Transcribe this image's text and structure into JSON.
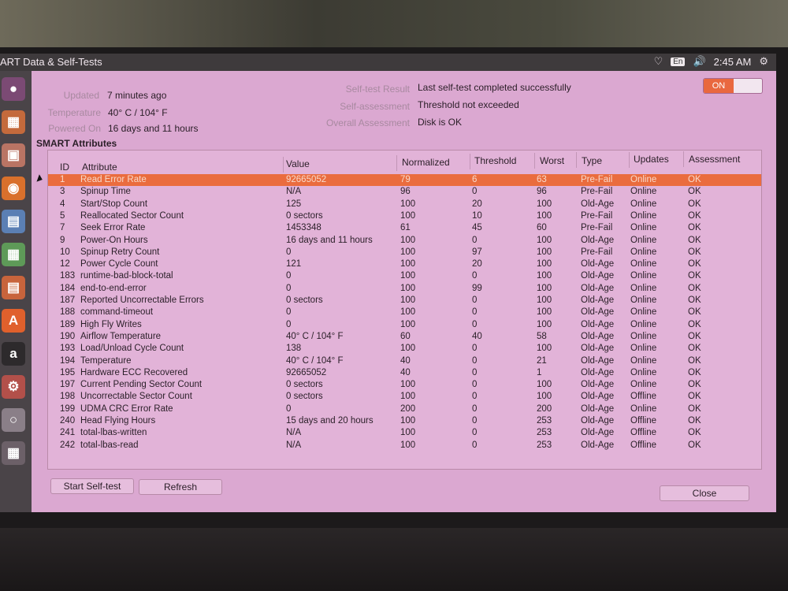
{
  "top_panel": {
    "window_title": "ART Data & Self-Tests",
    "keyboard_layout": "En",
    "clock": "2:45 AM"
  },
  "summary": {
    "updated_label": "Updated",
    "updated_value": "7 minutes ago",
    "temperature_label": "Temperature",
    "temperature_value": "40° C / 104° F",
    "powered_on_label": "Powered On",
    "powered_on_value": "16 days and 11 hours",
    "self_test_result_label": "Self-test Result",
    "self_test_result_value": "Last self-test completed successfully",
    "self_assessment_label": "Self-assessment",
    "self_assessment_value": "Threshold not exceeded",
    "overall_assessment_label": "Overall Assessment",
    "overall_assessment_value": "Disk is OK",
    "smart_toggle": "ON"
  },
  "section_title": "SMART Attributes",
  "table": {
    "headers": [
      "ID",
      "Attribute",
      "Value",
      "Normalized",
      "Threshold",
      "Worst",
      "Type",
      "Updates",
      "Assessment"
    ],
    "rows": [
      {
        "id": "1",
        "attribute": "Read Error Rate",
        "value": "92665052",
        "normalized": "79",
        "threshold": "6",
        "worst": "63",
        "type": "Pre-Fail",
        "updates": "Online",
        "assessment": "OK"
      },
      {
        "id": "3",
        "attribute": "Spinup Time",
        "value": "N/A",
        "normalized": "96",
        "threshold": "0",
        "worst": "96",
        "type": "Pre-Fail",
        "updates": "Online",
        "assessment": "OK"
      },
      {
        "id": "4",
        "attribute": "Start/Stop Count",
        "value": "125",
        "normalized": "100",
        "threshold": "20",
        "worst": "100",
        "type": "Old-Age",
        "updates": "Online",
        "assessment": "OK"
      },
      {
        "id": "5",
        "attribute": "Reallocated Sector Count",
        "value": "0 sectors",
        "normalized": "100",
        "threshold": "10",
        "worst": "100",
        "type": "Pre-Fail",
        "updates": "Online",
        "assessment": "OK"
      },
      {
        "id": "7",
        "attribute": "Seek Error Rate",
        "value": "1453348",
        "normalized": "61",
        "threshold": "45",
        "worst": "60",
        "type": "Pre-Fail",
        "updates": "Online",
        "assessment": "OK"
      },
      {
        "id": "9",
        "attribute": "Power-On Hours",
        "value": "16 days and 11 hours",
        "normalized": "100",
        "threshold": "0",
        "worst": "100",
        "type": "Old-Age",
        "updates": "Online",
        "assessment": "OK"
      },
      {
        "id": "10",
        "attribute": "Spinup Retry Count",
        "value": "0",
        "normalized": "100",
        "threshold": "97",
        "worst": "100",
        "type": "Pre-Fail",
        "updates": "Online",
        "assessment": "OK"
      },
      {
        "id": "12",
        "attribute": "Power Cycle Count",
        "value": "121",
        "normalized": "100",
        "threshold": "20",
        "worst": "100",
        "type": "Old-Age",
        "updates": "Online",
        "assessment": "OK"
      },
      {
        "id": "183",
        "attribute": "runtime-bad-block-total",
        "value": "0",
        "normalized": "100",
        "threshold": "0",
        "worst": "100",
        "type": "Old-Age",
        "updates": "Online",
        "assessment": "OK"
      },
      {
        "id": "184",
        "attribute": "end-to-end-error",
        "value": "0",
        "normalized": "100",
        "threshold": "99",
        "worst": "100",
        "type": "Old-Age",
        "updates": "Online",
        "assessment": "OK"
      },
      {
        "id": "187",
        "attribute": "Reported Uncorrectable Errors",
        "value": "0 sectors",
        "normalized": "100",
        "threshold": "0",
        "worst": "100",
        "type": "Old-Age",
        "updates": "Online",
        "assessment": "OK"
      },
      {
        "id": "188",
        "attribute": "command-timeout",
        "value": "0",
        "normalized": "100",
        "threshold": "0",
        "worst": "100",
        "type": "Old-Age",
        "updates": "Online",
        "assessment": "OK"
      },
      {
        "id": "189",
        "attribute": "High Fly Writes",
        "value": "0",
        "normalized": "100",
        "threshold": "0",
        "worst": "100",
        "type": "Old-Age",
        "updates": "Online",
        "assessment": "OK"
      },
      {
        "id": "190",
        "attribute": "Airflow Temperature",
        "value": "40° C / 104° F",
        "normalized": "60",
        "threshold": "40",
        "worst": "58",
        "type": "Old-Age",
        "updates": "Online",
        "assessment": "OK"
      },
      {
        "id": "193",
        "attribute": "Load/Unload Cycle Count",
        "value": "138",
        "normalized": "100",
        "threshold": "0",
        "worst": "100",
        "type": "Old-Age",
        "updates": "Online",
        "assessment": "OK"
      },
      {
        "id": "194",
        "attribute": "Temperature",
        "value": "40° C / 104° F",
        "normalized": "40",
        "threshold": "0",
        "worst": "21",
        "type": "Old-Age",
        "updates": "Online",
        "assessment": "OK"
      },
      {
        "id": "195",
        "attribute": "Hardware ECC Recovered",
        "value": "92665052",
        "normalized": "40",
        "threshold": "0",
        "worst": "1",
        "type": "Old-Age",
        "updates": "Online",
        "assessment": "OK"
      },
      {
        "id": "197",
        "attribute": "Current Pending Sector Count",
        "value": "0 sectors",
        "normalized": "100",
        "threshold": "0",
        "worst": "100",
        "type": "Old-Age",
        "updates": "Online",
        "assessment": "OK"
      },
      {
        "id": "198",
        "attribute": "Uncorrectable Sector Count",
        "value": "0 sectors",
        "normalized": "100",
        "threshold": "0",
        "worst": "100",
        "type": "Old-Age",
        "updates": "Offline",
        "assessment": "OK"
      },
      {
        "id": "199",
        "attribute": "UDMA CRC Error Rate",
        "value": "0",
        "normalized": "200",
        "threshold": "0",
        "worst": "200",
        "type": "Old-Age",
        "updates": "Online",
        "assessment": "OK"
      },
      {
        "id": "240",
        "attribute": "Head Flying Hours",
        "value": "15 days and 20 hours",
        "normalized": "100",
        "threshold": "0",
        "worst": "253",
        "type": "Old-Age",
        "updates": "Offline",
        "assessment": "OK"
      },
      {
        "id": "241",
        "attribute": "total-lbas-written",
        "value": "N/A",
        "normalized": "100",
        "threshold": "0",
        "worst": "253",
        "type": "Old-Age",
        "updates": "Offline",
        "assessment": "OK"
      },
      {
        "id": "242",
        "attribute": "total-lbas-read",
        "value": "N/A",
        "normalized": "100",
        "threshold": "0",
        "worst": "253",
        "type": "Old-Age",
        "updates": "Offline",
        "assessment": "OK"
      }
    ]
  },
  "buttons": {
    "start_self_test": "Start Self-test",
    "refresh": "Refresh",
    "close": "Close"
  },
  "launcher": {
    "icons": [
      "dash-icon",
      "files-icon",
      "folder-icon",
      "firefox-icon",
      "writer-icon",
      "calc-icon",
      "impress-icon",
      "software-center-icon",
      "amazon-icon",
      "settings-icon",
      "disks-icon",
      "workspaces-icon"
    ],
    "amazon_letter": "a"
  }
}
